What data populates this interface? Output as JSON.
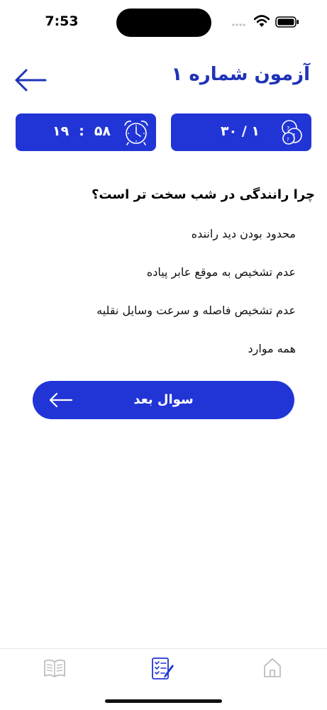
{
  "status_bar": {
    "time": "7:53"
  },
  "header": {
    "title": "آزمون شماره ۱",
    "back_icon": "arrow-left-icon"
  },
  "counter": {
    "text": "۱ / ۳۰",
    "icon": "question-bubbles-icon"
  },
  "timer": {
    "minutes": "۵۸",
    "seconds": "۱۹",
    "separator": ":",
    "icon": "alarm-clock-icon"
  },
  "question": {
    "text": "چرا رانندگی در شب سخت تر است؟",
    "options": [
      "محدود بودن دید راننده",
      "عدم تشخیص به موقع عابر پیاده",
      "عدم تشخیص فاصله و سرعت وسایل نقلیه",
      "همه موارد"
    ]
  },
  "next_button": {
    "label": "سوال بعد",
    "icon": "arrow-left-icon"
  },
  "tabs": [
    {
      "name": "book",
      "icon": "book-icon"
    },
    {
      "name": "exam",
      "icon": "exam-checklist-icon",
      "active": true
    },
    {
      "name": "home",
      "icon": "home-icon"
    }
  ],
  "colors": {
    "accent": "#2135d6",
    "title": "#1f33b8",
    "inactive_icon": "#b5b5b5"
  }
}
